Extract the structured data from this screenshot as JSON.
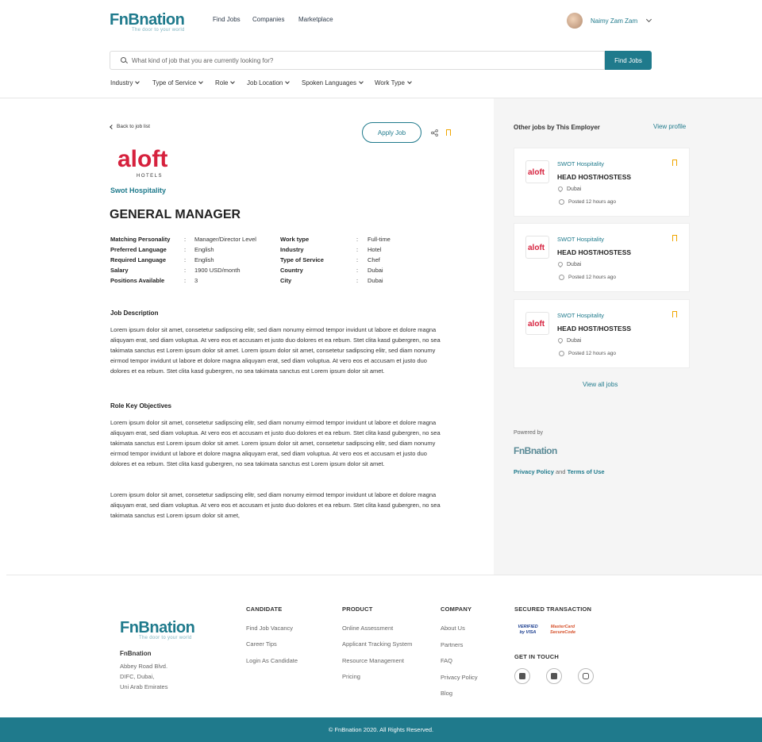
{
  "header": {
    "logo_text": "FnBnation",
    "logo_tagline": "The door to your world",
    "nav": [
      "Find Jobs",
      "Companies",
      "Marketplace"
    ],
    "user_name": "Naimy Zam Zam",
    "search_placeholder": "What kind of job that you are currently looking for?",
    "find_button": "Find Jobs",
    "filters": [
      "Industry",
      "Type of Service",
      "Role",
      "Job Location",
      "Spoken Languages",
      "Work Type"
    ]
  },
  "job": {
    "back_label": "Back to job list",
    "apply_label": "Apply Job",
    "company_logo_text": "aloft",
    "company_logo_sub": "HOTELS",
    "company_name": "Swot Hospitality",
    "title": "GENERAL MANAGER",
    "details_left": [
      {
        "label": "Matching Personality",
        "value": "Manager/Director Level"
      },
      {
        "label": "Preferred Language",
        "value": "English"
      },
      {
        "label": "Required Language",
        "value": "English"
      },
      {
        "label": "Salary",
        "value": "1900 USD/month"
      },
      {
        "label": "Positions Available",
        "value": "3"
      }
    ],
    "details_right": [
      {
        "label": "Work type",
        "value": "Full-time"
      },
      {
        "label": "Industry",
        "value": "Hotel"
      },
      {
        "label": "Type of Service",
        "value": "Chef"
      },
      {
        "label": "Country",
        "value": "Dubai"
      },
      {
        "label": "City",
        "value": "Dubai"
      }
    ],
    "description_title": "Job Description",
    "description": "Lorem ipsum dolor sit amet, consetetur sadipscing elitr, sed diam nonumy eirmod tempor invidunt ut labore et dolore magna aliquyam erat, sed diam voluptua. At vero eos et accusam et justo duo dolores et ea rebum. Stet clita kasd gubergren, no sea takimata sanctus est Lorem ipsum dolor sit amet. Lorem ipsum dolor sit amet, consetetur sadipscing elitr, sed diam nonumy eirmod tempor invidunt ut labore et dolore magna aliquyam erat, sed diam voluptua. At vero eos et accusam et justo duo dolores et ea rebum. Stet clita kasd gubergren, no sea takimata sanctus est Lorem ipsum dolor sit amet.",
    "objectives_title": "Role Key Objectives",
    "objectives_1": "Lorem ipsum dolor sit amet, consetetur sadipscing elitr, sed diam nonumy eirmod tempor invidunt ut labore et dolore magna aliquyam erat, sed diam voluptua. At vero eos et accusam et justo duo dolores et ea rebum. Stet clita kasd gubergren, no sea takimata sanctus est Lorem ipsum dolor sit amet. Lorem ipsum dolor sit amet, consetetur sadipscing elitr, sed diam nonumy eirmod tempor invidunt ut labore et dolore magna aliquyam erat, sed diam voluptua. At vero eos et accusam et justo duo dolores et ea rebum. Stet clita kasd gubergren, no sea takimata sanctus est Lorem ipsum dolor sit amet.",
    "objectives_2": "Lorem ipsum dolor sit amet, consetetur sadipscing elitr, sed diam nonumy eirmod tempor invidunt ut labore et dolore magna aliquyam erat, sed diam voluptua. At vero eos et accusam et justo duo dolores et ea rebum. Stet clita kasd gubergren, no sea takimata sanctus est Lorem ipsum dolor sit amet,"
  },
  "sidebar": {
    "title": "Other jobs by This Employer",
    "view_profile": "View profile",
    "jobs": [
      {
        "company": "SWOT Hospitality",
        "title": "HEAD HOST/HOSTESS",
        "location": "Dubai",
        "posted": "Posted 12 hours ago"
      },
      {
        "company": "SWOT Hospitality",
        "title": "HEAD HOST/HOSTESS",
        "location": "Dubai",
        "posted": "Posted 12 hours ago"
      },
      {
        "company": "SWOT Hospitality",
        "title": "HEAD HOST/HOSTESS",
        "location": "Dubai",
        "posted": "Posted 12 hours ago"
      }
    ],
    "view_all": "View all jobs",
    "powered_by": "Powered by",
    "privacy": "Privacy Policy",
    "and": "and",
    "terms": "Terms of Use"
  },
  "footer": {
    "company_name": "FnBnation",
    "address": [
      "Abbey Road Blvd.",
      "DIFC, Dubai,",
      "Uni Arab Emirates"
    ],
    "candidate_title": "CANDIDATE",
    "candidate_links": [
      "Find Job Vacancy",
      "Career Tips",
      "Login As Candidate"
    ],
    "product_title": "PRODUCT",
    "product_links": [
      "Online Assessment",
      "Applicant Tracking System",
      "Resource Management",
      "Pricing"
    ],
    "company_title": "COMPANY",
    "company_links": [
      "About Us",
      "Partners",
      "FAQ",
      "Privacy Policy",
      "Blog"
    ],
    "secured_title": "SECURED TRANSACTION",
    "verified_text": "VERIFIED by VISA",
    "mastercard_text": "MasterCard SecureCode",
    "touch_title": "GET IN TOUCH",
    "copyright": "© FnBnation 2020. All Rights Reserved."
  }
}
